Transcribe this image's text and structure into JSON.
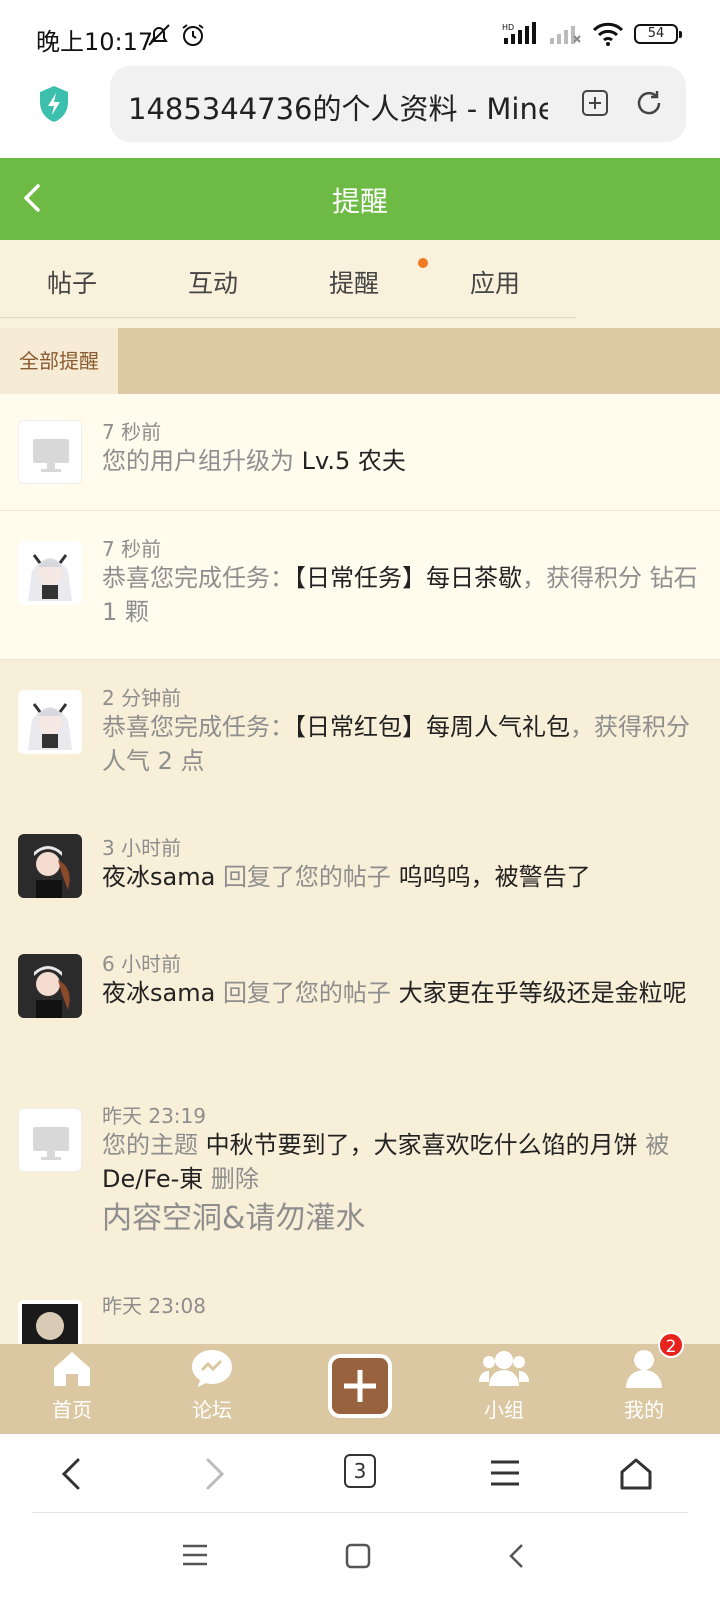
{
  "status_bar": {
    "time": "晚上10:17",
    "icons_left": [
      "bell-off-icon",
      "alarm-icon"
    ],
    "icons_right": [
      "hd-signal-icon",
      "signal-icon",
      "wifi-icon"
    ],
    "battery": "54"
  },
  "browser": {
    "url_text": "1485344736的个人资料 - Mine",
    "tab_count": "3"
  },
  "header": {
    "title": "提醒",
    "color": "#6dbb45"
  },
  "tabs": [
    {
      "label": "帖子"
    },
    {
      "label": "互动"
    },
    {
      "label": "提醒",
      "has_dot": true
    },
    {
      "label": "应用"
    }
  ],
  "filter": {
    "label": "全部提醒"
  },
  "notifications": [
    {
      "time": "7 秒前",
      "avatar": "system",
      "parts": [
        [
          "g",
          "您的用户组升级为 "
        ],
        [
          "k",
          "Lv.5 农夫"
        ]
      ]
    },
    {
      "time": "7 秒前",
      "avatar": "anime-girl",
      "parts": [
        [
          "g",
          "恭喜您完成任务："
        ],
        [
          "k",
          "【日常任务】每日茶歇"
        ],
        [
          "g",
          "，获得积分 钻石 1 颗"
        ]
      ]
    },
    {
      "time": "2 分钟前",
      "avatar": "anime-girl",
      "parts": [
        [
          "g",
          "恭喜您完成任务："
        ],
        [
          "k",
          "【日常红包】每周人气礼包"
        ],
        [
          "g",
          "，获得积分 人气 2 点"
        ]
      ]
    },
    {
      "time": "3 小时前",
      "avatar": "dark-girl",
      "parts": [
        [
          "k",
          "夜冰sama "
        ],
        [
          "g",
          "回复了您的帖子 "
        ],
        [
          "k",
          "呜呜呜，被警告了"
        ]
      ]
    },
    {
      "time": "6 小时前",
      "avatar": "dark-girl",
      "parts": [
        [
          "k",
          "夜冰sama "
        ],
        [
          "g",
          "回复了您的帖子 "
        ],
        [
          "k",
          "大家更在乎等级还是金粒呢"
        ]
      ]
    },
    {
      "time": "昨天 23:19",
      "avatar": "system",
      "parts": [
        [
          "g",
          "您的主题 "
        ],
        [
          "k",
          "中秋节要到了，大家喜欢吃什么馅的月饼"
        ],
        [
          "g",
          " 被 "
        ],
        [
          "k",
          "De/Fe-東 "
        ],
        [
          "g",
          "删除"
        ]
      ],
      "reason": "内容空洞&请勿灌水"
    },
    {
      "time": "昨天 23:08",
      "avatar": "photo"
    }
  ],
  "bottom_nav": [
    {
      "label": "首页",
      "icon": "home-icon"
    },
    {
      "label": "论坛",
      "icon": "forum-icon"
    },
    {
      "label": "",
      "icon": "plus-icon"
    },
    {
      "label": "小组",
      "icon": "group-icon"
    },
    {
      "label": "我的",
      "icon": "user-icon",
      "badge": "2"
    }
  ]
}
